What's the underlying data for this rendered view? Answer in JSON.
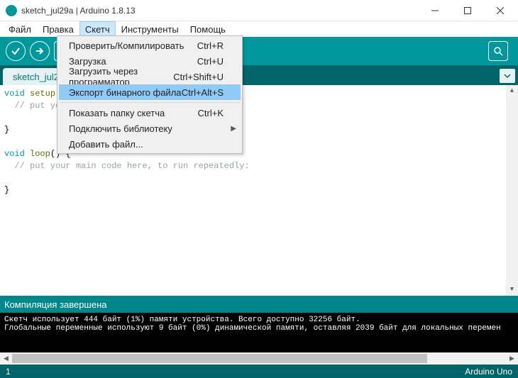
{
  "window": {
    "title": "sketch_jul29a | Arduino 1.8.13"
  },
  "menubar": {
    "items": [
      "Файл",
      "Правка",
      "Скетч",
      "Инструменты",
      "Помощь"
    ],
    "open_index": 2
  },
  "dropdown": {
    "items": [
      {
        "label": "Проверить/Компилировать",
        "shortcut": "Ctrl+R"
      },
      {
        "label": "Загрузка",
        "shortcut": "Ctrl+U"
      },
      {
        "label": "Загрузить через программатор",
        "shortcut": "Ctrl+Shift+U"
      },
      {
        "label": "Экспорт бинарного файла",
        "shortcut": "Ctrl+Alt+S",
        "highlight": true
      }
    ],
    "items2": [
      {
        "label": "Показать папку скетча",
        "shortcut": "Ctrl+K"
      },
      {
        "label": "Подключить библиотеку",
        "submenu": true
      },
      {
        "label": "Добавить файл..."
      }
    ]
  },
  "toolbar": {
    "buttons": [
      "verify",
      "upload",
      "new",
      "open",
      "save"
    ],
    "serial": "serial-monitor"
  },
  "tabs": {
    "active": "sketch_jul29"
  },
  "code": {
    "l1a": "void",
    "l1b": " ",
    "l1c": "setup",
    "l1d": "(",
    "l2": "  // put yo",
    "l3": "",
    "l4": "}",
    "l5": "",
    "l6a": "void",
    "l6b": " ",
    "l6c": "loop",
    "l6d": "() {",
    "l7": "  // put your main code here, to run repeatedly:",
    "l8": "",
    "l9": "}"
  },
  "status": {
    "message": "Компиляция завершена"
  },
  "console_lines": [
    "Скетч использует 444 байт (1%) памяти устройства. Всего доступно 32256 байт.",
    "Глобальные переменные используют 9 байт (0%) динамической памяти, оставляя 2039 байт для локальных перемен"
  ],
  "footer": {
    "line": "1",
    "board": "Arduino Uno"
  }
}
